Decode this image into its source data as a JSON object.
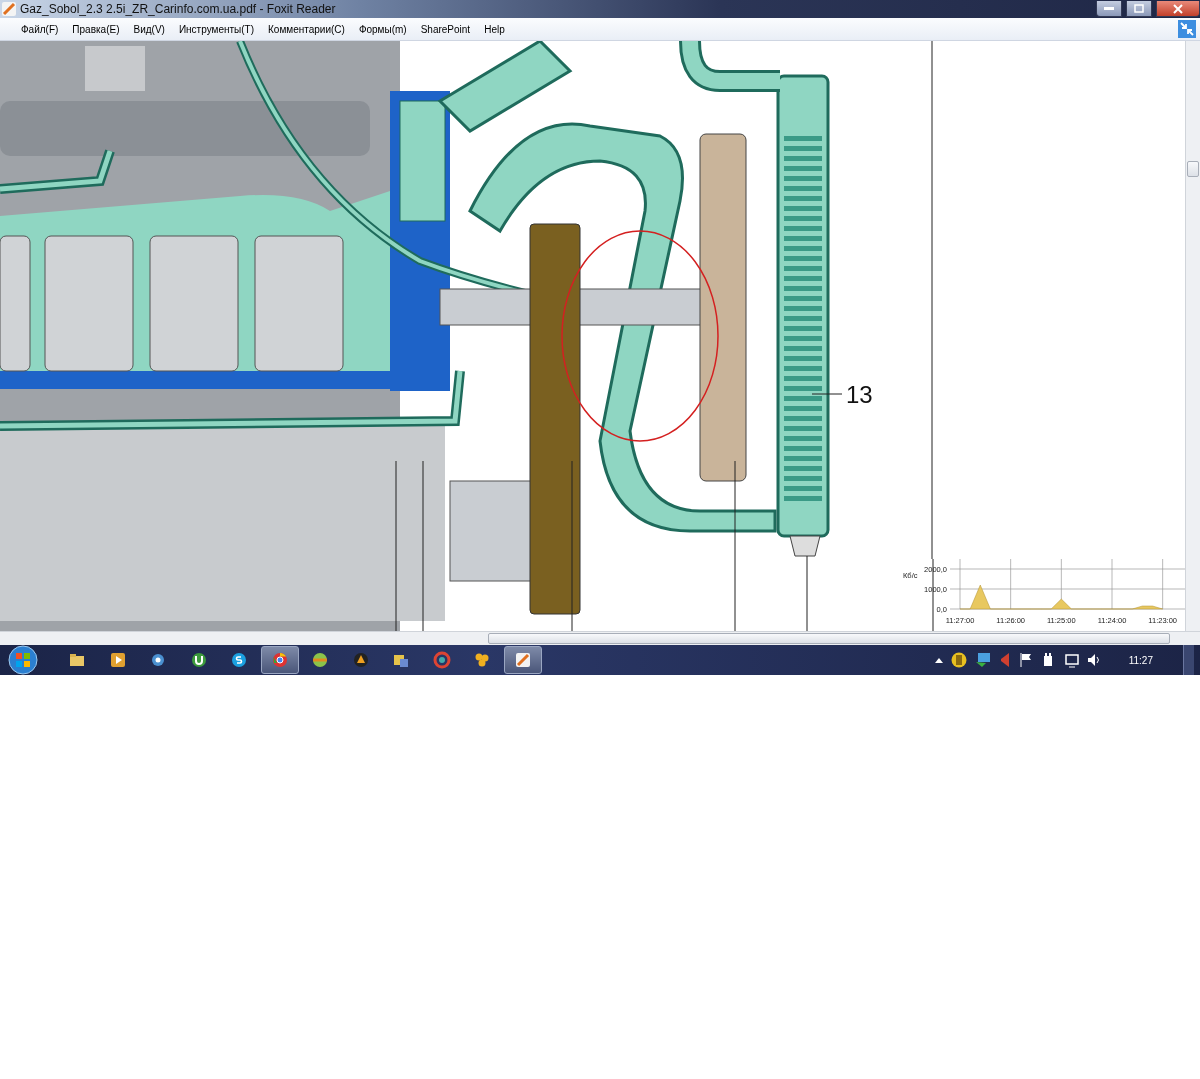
{
  "window": {
    "title": "Gaz_Sobol_2.3 2.5i_ZR_Carinfo.com.ua.pdf - Foxit Reader"
  },
  "menu": [
    "Файл(F)",
    "Правка(E)",
    "Вид(V)",
    "Инструменты(T)",
    "Комментарии(C)",
    "Формы(m)",
    "SharePoint",
    "Help"
  ],
  "document": {
    "callout": "13"
  },
  "traffic_widget": {
    "chart_data": {
      "type": "area",
      "ylabel": "Кб/с",
      "categories": [
        "11:27:00",
        null,
        null,
        null,
        null,
        "11:26:00",
        null,
        null,
        null,
        null,
        "11:25:00",
        null,
        null,
        null,
        null,
        "11:24:00",
        null,
        null,
        null,
        null,
        "11:23:00"
      ],
      "values": [
        0,
        0,
        1200,
        0,
        0,
        0,
        0,
        0,
        0,
        0,
        500,
        0,
        0,
        0,
        0,
        0,
        0,
        0,
        150,
        150,
        0
      ],
      "ylim": [
        0,
        2000
      ],
      "grid": true,
      "yticks": [
        {
          "value": 0,
          "label": "0,0"
        },
        {
          "value": 1000,
          "label": "1000,0"
        },
        {
          "value": 2000,
          "label": "2000,0"
        }
      ]
    }
  },
  "taskbar": {
    "buttons": [
      {
        "selected": false
      },
      {
        "selected": false
      },
      {
        "selected": false
      },
      {
        "selected": false
      },
      {
        "selected": false
      },
      {
        "selected": true
      },
      {
        "selected": false
      },
      {
        "selected": false
      },
      {
        "selected": false
      },
      {
        "selected": false
      },
      {
        "selected": false
      },
      {
        "selected": true
      }
    ],
    "clock": "11:27"
  }
}
